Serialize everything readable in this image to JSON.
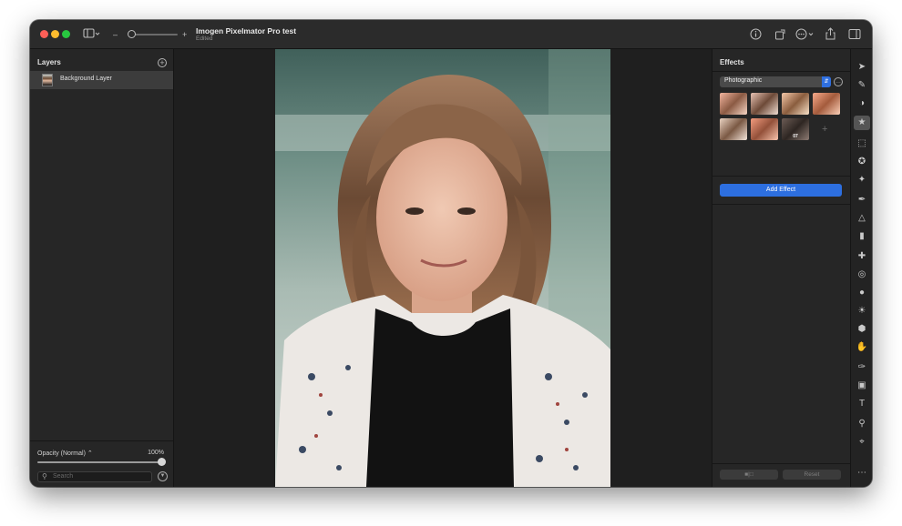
{
  "window": {
    "title": "Imogen Pixelmator Pro test",
    "subtitle": "Edited"
  },
  "toolbar": {
    "sidebar_icon": "sidebar-toggle-icon",
    "zoom_out": "–",
    "zoom_in": "+",
    "right_icons": [
      "info-icon",
      "share-arrange-icon",
      "more-ellipsis-icon",
      "export-icon",
      "inspector-toggle-icon"
    ]
  },
  "layers_panel": {
    "title": "Layers",
    "layers": [
      {
        "name": "Background Layer",
        "selected": true
      }
    ],
    "opacity_label": "Opacity (Normal) ⌃",
    "opacity_value": "100%",
    "search_placeholder": "Search"
  },
  "effects_panel": {
    "title": "Effects",
    "preset": "Photographic",
    "thumb_label": "07",
    "add_effect_label": "Add Effect",
    "footer_left": "■|□",
    "footer_right": "Reset"
  },
  "tools": [
    "arrange-icon",
    "style-icon",
    "color-adjust-icon",
    "effects-icon",
    "select-rect-icon",
    "lasso-icon",
    "magic-wand-icon",
    "paint-brush-icon",
    "paint-bucket-icon",
    "eraser-icon",
    "repair-icon",
    "clone-icon",
    "blur-icon",
    "lighten-icon",
    "sponge-icon",
    "smudge-icon",
    "pen-icon",
    "shape-icon",
    "text-icon",
    "zoom-icon",
    "crop-icon",
    "more-tools-icon"
  ],
  "colors": {
    "accent": "#2d6fe0",
    "window_bg": "#1e1e1e",
    "panel_bg": "#262626"
  }
}
